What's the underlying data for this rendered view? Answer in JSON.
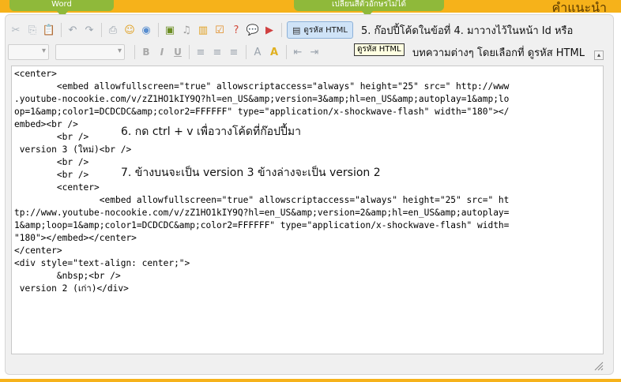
{
  "top": {
    "tab_word": "Word",
    "tab_thai": "เปลี่ยนสีตัวอักษรไม่ได้",
    "right_label": "คำแนะนำ"
  },
  "toolbar": {
    "html_button_label": "ดูรหัส HTML",
    "tooltip": "ดูรหัส HTML",
    "icons": [
      "cut-icon",
      "copy-icon",
      "paste-icon",
      "undo-icon",
      "redo-icon",
      "print-icon",
      "smiley-icon",
      "special-icon",
      "image-icon",
      "music-icon",
      "chart-icon",
      "checklist-icon",
      "help-icon",
      "chat-icon",
      "youtube-icon"
    ]
  },
  "format": {
    "bold": "B",
    "italic": "I",
    "underline": "U"
  },
  "notes": {
    "step5_line1": "5. ก๊อปปี้โค้ดในข้อที่ 4. มาวางไว้ในหน้า Id หรือ",
    "step5_line2": "บทความต่างๆ โดยเลือกที่ ดูรหัส HTML",
    "step6": "6. กด ctrl + v เพื่อวางโค้ดที่ก๊อปปี้มา",
    "step7": "7. ข้างบนจะเป็น version 3 ข้างล่างจะเป็น version 2"
  },
  "code": [
    "<center>",
    "        <embed allowfullscreen=\"true\" allowscriptaccess=\"always\" height=\"25\" src=\" http://www",
    ".youtube-nocookie.com/v/zZ1HO1kIY9Q?hl=en_US&amp;version=3&amp;hl=en_US&amp;autoplay=1&amp;lo",
    "op=1&amp;color1=DCDCDC&amp;color2=FFFFFF\" type=\"application/x-shockwave-flash\" width=\"180\"></",
    "embed><br />",
    "        <br />",
    " version 3 (ใหม่)<br />",
    "        <br />",
    "        <br />",
    "        <center>",
    "                <embed allowfullscreen=\"true\" allowscriptaccess=\"always\" height=\"25\" src=\" ht",
    "tp://www.youtube-nocookie.com/v/zZ1HO1kIY9Q?hl=en_US&amp;version=2&amp;hl=en_US&amp;autoplay=",
    "1&amp;loop=1&amp;color1=DCDCDC&amp;color2=FFFFFF\" type=\"application/x-shockwave-flash\" width=",
    "\"180\"></embed></center>",
    "</center>",
    "<div style=\"text-align: center;\">",
    "        &nbsp;<br />",
    " version 2 (เก่า)</div>"
  ]
}
